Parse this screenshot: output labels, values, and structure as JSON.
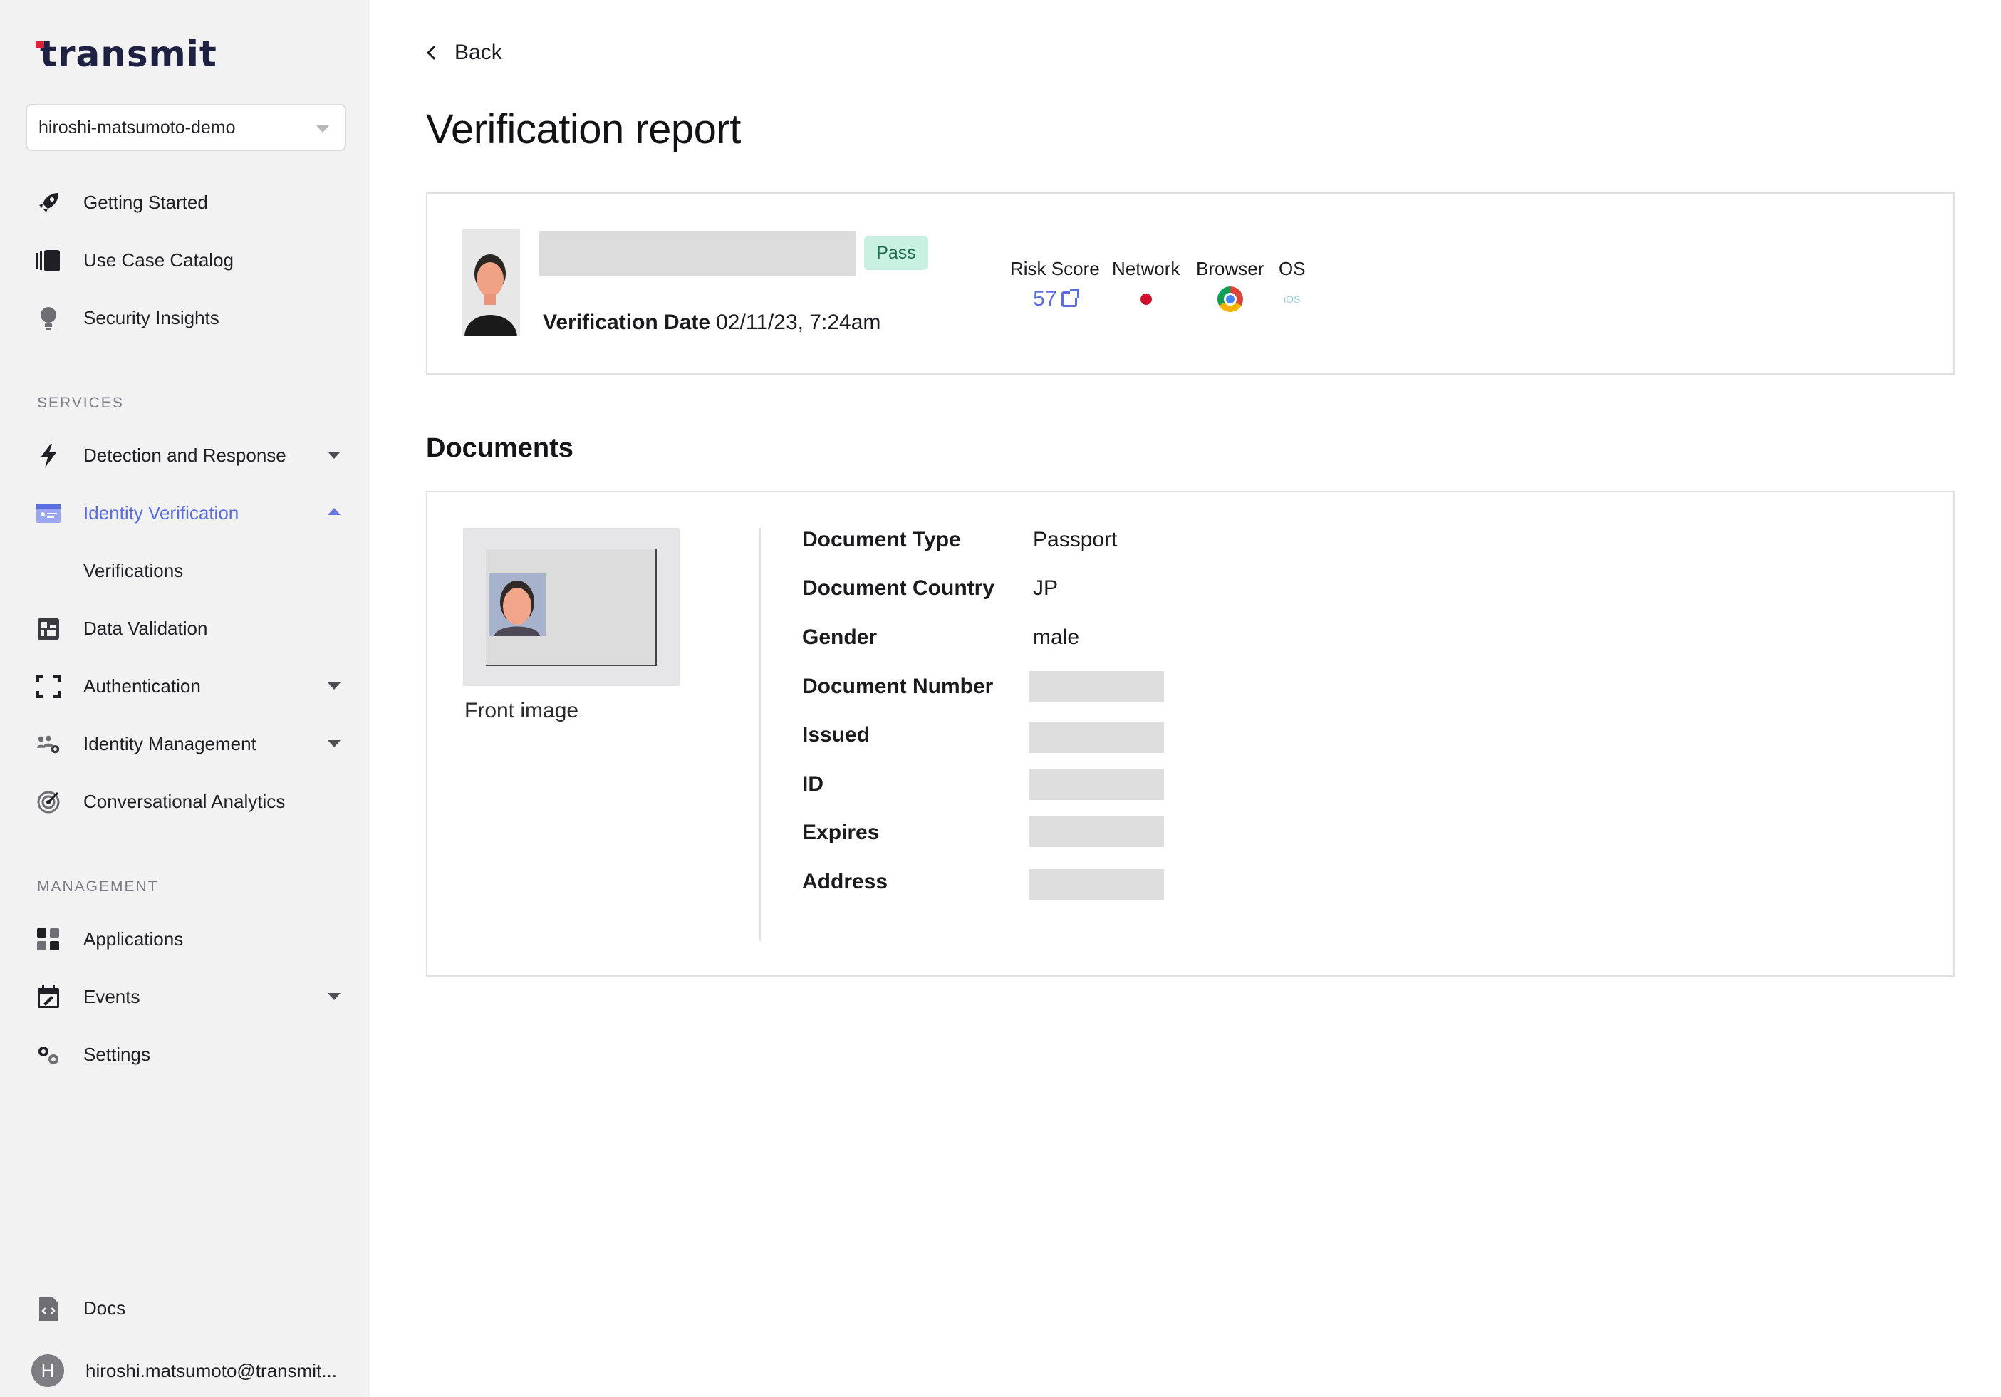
{
  "brand": {
    "logo_text": "transmit",
    "accent": "#5b6ee1",
    "logo_mark_color": "#d6263e"
  },
  "tenant": {
    "selected": "hiroshi-matsumoto-demo"
  },
  "sidebar": {
    "top_items": [
      {
        "label": "Getting Started",
        "icon": "rocket-icon"
      },
      {
        "label": "Use Case Catalog",
        "icon": "catalog-icon"
      },
      {
        "label": "Security Insights",
        "icon": "lightbulb-icon"
      }
    ],
    "services_label": "SERVICES",
    "services": [
      {
        "label": "Detection and Response",
        "icon": "bolt-icon",
        "expandable": true
      },
      {
        "label": "Identity Verification",
        "icon": "id-card-icon",
        "expanded": true,
        "active": true
      },
      {
        "label": "Verifications",
        "sub": true
      },
      {
        "label": "Data Validation",
        "icon": "data-validation-icon"
      },
      {
        "label": "Authentication",
        "icon": "scan-frame-icon",
        "expandable": true
      },
      {
        "label": "Identity Management",
        "icon": "users-gear-icon",
        "expandable": true
      },
      {
        "label": "Conversational Analytics",
        "icon": "radar-icon"
      }
    ],
    "management_label": "MANAGEMENT",
    "management": [
      {
        "label": "Applications",
        "icon": "apps-grid-icon"
      },
      {
        "label": "Events",
        "icon": "calendar-icon",
        "expandable": true
      },
      {
        "label": "Settings",
        "icon": "gears-icon"
      }
    ],
    "docs_label": "Docs",
    "user": {
      "avatar_initial": "H",
      "email": "hiroshi.matsumoto@transmit..."
    }
  },
  "header": {
    "back_label": "Back",
    "title": "Verification report"
  },
  "summary": {
    "status": "Pass",
    "verification_date_label": "Verification Date",
    "verification_date": "02/11/23, 7:24am",
    "risk_score_label": "Risk Score",
    "risk_score": "57",
    "network_label": "Network",
    "browser_label": "Browser",
    "os_label": "OS",
    "os_value": "iOS"
  },
  "documents": {
    "title": "Documents",
    "front_image_label": "Front image",
    "fields": [
      {
        "key": "Document Type",
        "value": "Passport"
      },
      {
        "key": "Document Country",
        "value": "JP"
      },
      {
        "key": "Gender",
        "value": "male"
      },
      {
        "key": "Document Number",
        "value": null
      },
      {
        "key": "Issued",
        "value": null
      },
      {
        "key": "ID",
        "value": null
      },
      {
        "key": "Expires",
        "value": null
      },
      {
        "key": "Address",
        "value": null
      }
    ]
  }
}
